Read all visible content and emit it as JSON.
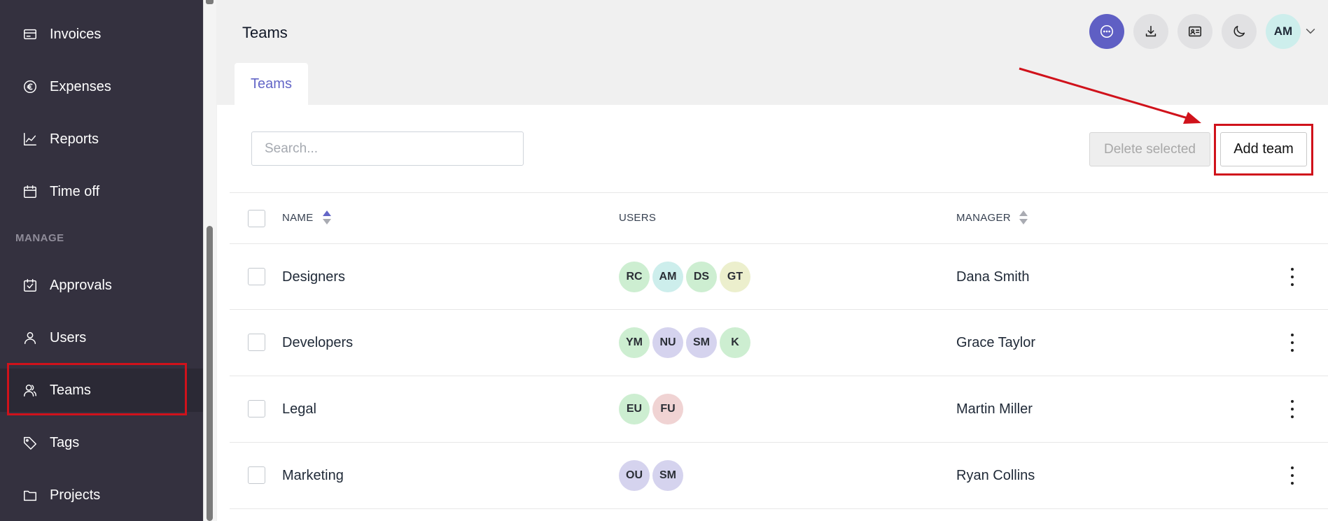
{
  "sidebar": {
    "items": [
      {
        "label": "Invoices",
        "icon": "invoice-icon"
      },
      {
        "label": "Expenses",
        "icon": "euro-icon"
      },
      {
        "label": "Reports",
        "icon": "chart-icon"
      },
      {
        "label": "Time off",
        "icon": "calendar-icon"
      },
      {
        "label": "Approvals",
        "icon": "calendar-check-icon"
      },
      {
        "label": "Users",
        "icon": "user-icon"
      },
      {
        "label": "Teams",
        "icon": "users-icon"
      },
      {
        "label": "Tags",
        "icon": "tag-icon"
      },
      {
        "label": "Projects",
        "icon": "folder-icon"
      }
    ],
    "section_manage": "MANAGE",
    "active": "Teams"
  },
  "header": {
    "title": "Teams",
    "avatar_initials": "AM"
  },
  "tabs": [
    {
      "label": "Teams"
    }
  ],
  "toolbar": {
    "search_placeholder": "Search...",
    "delete_label": "Delete selected",
    "add_label": "Add team"
  },
  "table": {
    "columns": {
      "name": "NAME",
      "users": "USERS",
      "manager": "MANAGER"
    },
    "rows": [
      {
        "name": "Designers",
        "users": [
          {
            "initials": "RC",
            "color": "#cdeed1"
          },
          {
            "initials": "AM",
            "color": "#cdeeec"
          },
          {
            "initials": "DS",
            "color": "#cdeed1"
          },
          {
            "initials": "GT",
            "color": "#ecefcd"
          }
        ],
        "manager": "Dana Smith"
      },
      {
        "name": "Developers",
        "users": [
          {
            "initials": "YM",
            "color": "#cdeed1"
          },
          {
            "initials": "NU",
            "color": "#d5d3ee"
          },
          {
            "initials": "SM",
            "color": "#d5d3ee"
          },
          {
            "initials": "K",
            "color": "#cdeed1"
          }
        ],
        "manager": "Grace Taylor"
      },
      {
        "name": "Legal",
        "users": [
          {
            "initials": "EU",
            "color": "#cdeed1"
          },
          {
            "initials": "FU",
            "color": "#f0d3d3"
          }
        ],
        "manager": "Martin Miller"
      },
      {
        "name": "Marketing",
        "users": [
          {
            "initials": "OU",
            "color": "#d5d3ee"
          },
          {
            "initials": "SM",
            "color": "#d5d3ee"
          }
        ],
        "manager": "Ryan Collins"
      }
    ]
  },
  "colors": {
    "accent": "#6366c7",
    "sidebar_bg": "#34313f",
    "highlight": "#d0121b"
  }
}
